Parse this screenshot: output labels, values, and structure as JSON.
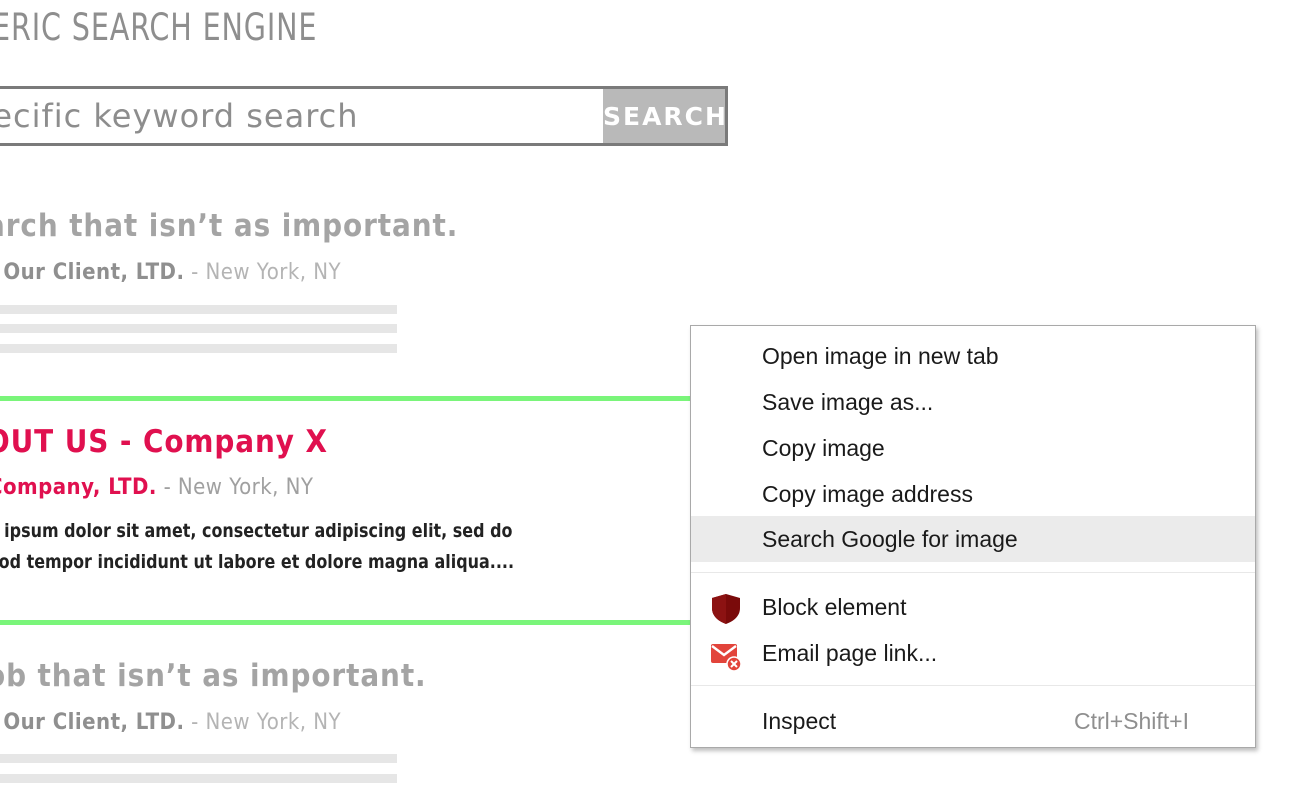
{
  "page": {
    "engine_title": "ERIC SEARCH ENGINE",
    "search": {
      "placeholder": "pecific keyword search",
      "button_label": "SEARCH"
    },
    "results": [
      {
        "title": "arch that isn’t as important.",
        "company": "’ Our Client, LTD.",
        "location": " - New York, NY"
      },
      {
        "title": "OUT US - Company X",
        "company": "Company, LTD.",
        "location": " - New York, NY",
        "snippet_line1": "m ipsum dolor sit amet, consectetur adipiscing elit, sed do",
        "snippet_line2": "mod tempor incididunt ut labore et dolore magna aliqua...."
      },
      {
        "title": "ob that isn’t as important.",
        "company": "’ Our Client, LTD.",
        "location": " - New York, NY"
      }
    ]
  },
  "context_menu": {
    "items": [
      {
        "label": "Open image in new tab"
      },
      {
        "label": "Save image as..."
      },
      {
        "label": "Copy image"
      },
      {
        "label": "Copy image address"
      },
      {
        "label": "Search Google for image",
        "highlighted": true
      },
      {
        "label": "Block element",
        "icon": "shield-icon"
      },
      {
        "label": "Email page link...",
        "icon": "email-icon"
      },
      {
        "label": "Inspect",
        "shortcut": "Ctrl+Shift+I"
      }
    ]
  },
  "colors": {
    "accent_pink": "#e0104f",
    "highlight_green": "#7af57a",
    "menu_hover": "#ebebeb",
    "shield_red": "#7a0a0a"
  }
}
